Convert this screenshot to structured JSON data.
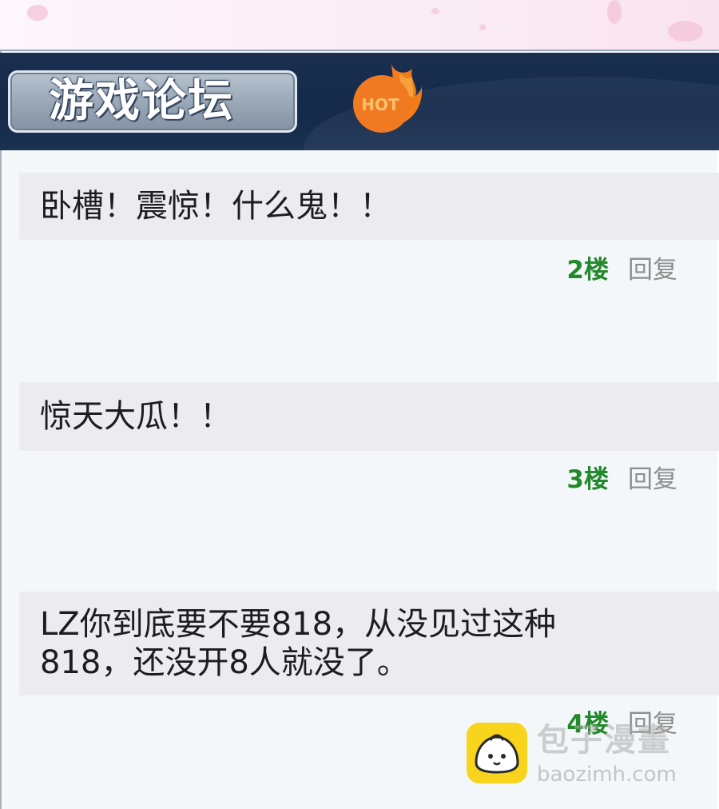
{
  "header": {
    "title": "游戏论坛",
    "hot_badge": "HOT"
  },
  "posts": [
    {
      "text": "卧槽！震惊！什么鬼！！",
      "floor": "2楼",
      "reply": "回复"
    },
    {
      "text": "惊天大瓜！！",
      "floor": "3楼",
      "reply": "回复"
    },
    {
      "text_line1": "LZ你到底要不要818，从没见过这种",
      "text_line2": "818，还没开8人就没了。",
      "floor": "4楼",
      "reply": "回复"
    }
  ],
  "watermark": {
    "name": "包子漫畫",
    "url": "baozimh.com"
  },
  "colors": {
    "header_bg": "#15294a",
    "floor_green": "#22892a",
    "reply_gray": "#8e8e8e",
    "bubble_bg": "#ececee",
    "hot_orange": "#f27b1a"
  },
  "icons": [
    "hot-flame-icon",
    "bun-logo-icon"
  ]
}
